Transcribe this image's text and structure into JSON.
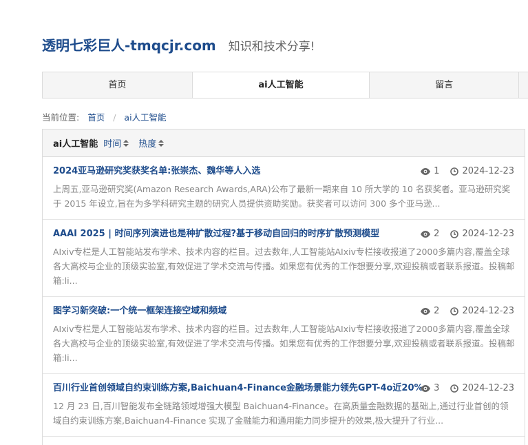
{
  "site": {
    "title": "透明七彩巨人-tmqcjr.com",
    "slogan": "知识和技术分享!"
  },
  "nav": {
    "items": [
      {
        "label": "首页"
      },
      {
        "label": "ai人工智能"
      },
      {
        "label": "留言"
      }
    ]
  },
  "breadcrumb": {
    "prefix": "当前位置:",
    "home": "首页",
    "separator": "/",
    "current": "ai人工智能"
  },
  "panel": {
    "title": "ai人工智能",
    "sort_time": "时间",
    "sort_hot": "热度"
  },
  "articles": [
    {
      "title": "2024亚马逊研究奖获奖名单:张崇杰、魏华等人入选",
      "views": "1",
      "date": "2024-12-23",
      "summary": "上周五,亚马逊研究奖(Amazon Research Awards,ARA)公布了最新一期来自 10 所大学的 10 名获奖者。亚马逊研究奖于 2015 年设立,旨在为多学科研究主题的研究人员提供资助奖励。获奖者可以访问 300 多个亚马逊..."
    },
    {
      "title": "AAAI 2025 | 时间序列演进也是种扩散过程?基于移动自回归的时序扩散预测模型",
      "views": "2",
      "date": "2024-12-23",
      "summary": "AIxiv专栏是人工智能站发布学术、技术内容的栏目。过去数年,人工智能站AIxiv专栏接收报道了2000多篇内容,覆盖全球各大高校与企业的顶级实验室,有效促进了学术交流与传播。如果您有优秀的工作想要分享,欢迎投稿或者联系报道。投稿邮箱:li..."
    },
    {
      "title": "图学习新突破:一个统一框架连接空域和频域",
      "views": "2",
      "date": "2024-12-23",
      "summary": "AIxiv专栏是人工智能站发布学术、技术内容的栏目。过去数年,人工智能站AIxiv专栏接收报道了2000多篇内容,覆盖全球各大高校与企业的顶级实验室,有效促进了学术交流与传播。如果您有优秀的工作想要分享,欢迎投稿或者联系报道。投稿邮箱:li..."
    },
    {
      "title": "百川行业首创领域自约束训练方案,Baichuan4-Finance金融场景能力领先GPT-4o近20%",
      "views": "3",
      "date": "2024-12-23",
      "summary": "12 月 23 日,百川智能发布全链路领域增强大模型 Baichuan4-Finance。在高质量金融数据的基础上,通过行业首创的领域自约束训练方案,Baichuan4-Finance 实现了金融能力和通用能力同步提升的效果,极大提升了行业..."
    }
  ],
  "icons": {
    "views": "eye-icon",
    "date": "clock-icon"
  },
  "colors": {
    "brand": "#1e4c8c",
    "muted": "#888888"
  }
}
